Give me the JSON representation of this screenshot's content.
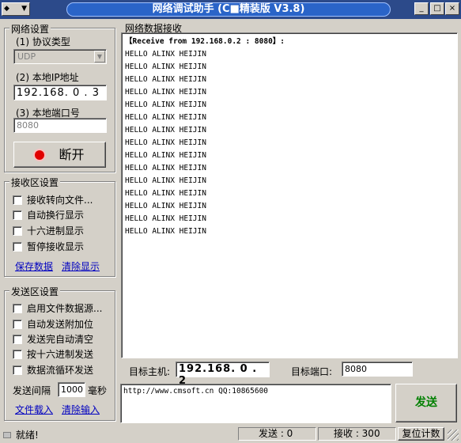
{
  "titlebar": {
    "title": "网络调试助手 (C■精装版 V3.8)",
    "sysmenu_label": "◆",
    "sysmenu_arrow": "▼",
    "minimize": "_",
    "maximize": "□",
    "close": "×"
  },
  "network_settings": {
    "title": "网络设置",
    "protocol_label": "(1) 协议类型",
    "protocol_value": "UDP",
    "ip_label": "(2) 本地IP地址",
    "ip_value": "192.168. 0 . 3",
    "port_label": "(3) 本地端口号",
    "port_value": "8080",
    "disconnect_label": "断开"
  },
  "receive_settings": {
    "title": "接收区设置",
    "options": [
      "接收转向文件...",
      "自动换行显示",
      "十六进制显示",
      "暂停接收显示"
    ],
    "save_link": "保存数据",
    "clear_link": "清除显示"
  },
  "send_settings": {
    "title": "发送区设置",
    "options": [
      "启用文件数据源...",
      "自动发送附加位",
      "发送完自动清空",
      "按十六进制发送",
      "数据流循环发送"
    ],
    "interval_label": "发送间隔",
    "interval_value": "1000",
    "interval_unit": "毫秒",
    "load_link": "文件载入",
    "clear_input_link": "清除输入"
  },
  "receive_area": {
    "title": "网络数据接收",
    "header_line": "【Receive from 192.168.0.2 : 8080】:",
    "lines": [
      "HELLO ALINX HEIJIN",
      "HELLO ALINX HEIJIN",
      "HELLO ALINX HEIJIN",
      "HELLO ALINX HEIJIN",
      "HELLO ALINX HEIJIN",
      "HELLO ALINX HEIJIN",
      "HELLO ALINX HEIJIN",
      "HELLO ALINX HEIJIN",
      "HELLO ALINX HEIJIN",
      "HELLO ALINX HEIJIN",
      "HELLO ALINX HEIJIN",
      "HELLO ALINX HEIJIN",
      "HELLO ALINX HEIJIN",
      "HELLO ALINX HEIJIN",
      "HELLO ALINX HEIJIN"
    ]
  },
  "target": {
    "host_label": "目标主机:",
    "host_value": "192.168. 0 . 2",
    "port_label": "目标端口:",
    "port_value": "8080"
  },
  "send_area": {
    "text": "http://www.cmsoft.cn QQ:10865600",
    "send_button": "发送"
  },
  "statusbar": {
    "status": "就绪!",
    "send_count": "发送 : 0",
    "recv_count": "接收 : 300",
    "reset_button": "复位计数"
  },
  "colors": {
    "send_button_text": "#008000",
    "record_icon": "#e00000",
    "link": "#0000c0"
  }
}
